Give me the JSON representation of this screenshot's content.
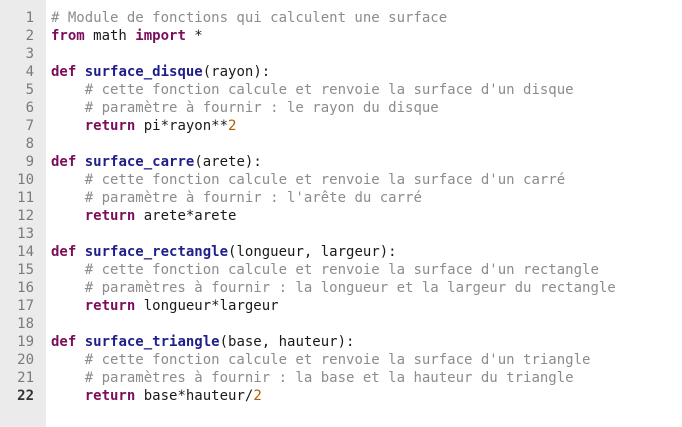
{
  "editor": {
    "current_line": 22,
    "lines": [
      {
        "n": "1",
        "tokens": [
          {
            "t": "cmt",
            "v": "# Module de fonctions qui calculent une surface"
          }
        ]
      },
      {
        "n": "2",
        "tokens": [
          {
            "t": "kw",
            "v": "from"
          },
          {
            "t": "txt",
            "v": " math "
          },
          {
            "t": "kw",
            "v": "import"
          },
          {
            "t": "txt",
            "v": " *"
          }
        ]
      },
      {
        "n": "3",
        "tokens": []
      },
      {
        "n": "4",
        "tokens": [
          {
            "t": "kw",
            "v": "def"
          },
          {
            "t": "txt",
            "v": " "
          },
          {
            "t": "fn",
            "v": "surface_disque"
          },
          {
            "t": "txt",
            "v": "(rayon):"
          }
        ]
      },
      {
        "n": "5",
        "tokens": [
          {
            "t": "txt",
            "v": "    "
          },
          {
            "t": "cmt",
            "v": "# cette fonction calcule et renvoie la surface d'un disque"
          }
        ]
      },
      {
        "n": "6",
        "tokens": [
          {
            "t": "txt",
            "v": "    "
          },
          {
            "t": "cmt",
            "v": "# paramètre à fournir : le rayon du disque"
          }
        ]
      },
      {
        "n": "7",
        "tokens": [
          {
            "t": "txt",
            "v": "    "
          },
          {
            "t": "kw",
            "v": "return"
          },
          {
            "t": "txt",
            "v": " pi*rayon**"
          },
          {
            "t": "num",
            "v": "2"
          }
        ]
      },
      {
        "n": "8",
        "tokens": []
      },
      {
        "n": "9",
        "tokens": [
          {
            "t": "kw",
            "v": "def"
          },
          {
            "t": "txt",
            "v": " "
          },
          {
            "t": "fn",
            "v": "surface_carre"
          },
          {
            "t": "txt",
            "v": "(arete):"
          }
        ]
      },
      {
        "n": "10",
        "tokens": [
          {
            "t": "txt",
            "v": "    "
          },
          {
            "t": "cmt",
            "v": "# cette fonction calcule et renvoie la surface d'un carré"
          }
        ]
      },
      {
        "n": "11",
        "tokens": [
          {
            "t": "txt",
            "v": "    "
          },
          {
            "t": "cmt",
            "v": "# paramètre à fournir : l'arête du carré"
          }
        ]
      },
      {
        "n": "12",
        "tokens": [
          {
            "t": "txt",
            "v": "    "
          },
          {
            "t": "kw",
            "v": "return"
          },
          {
            "t": "txt",
            "v": " arete*arete"
          }
        ]
      },
      {
        "n": "13",
        "tokens": []
      },
      {
        "n": "14",
        "tokens": [
          {
            "t": "kw",
            "v": "def"
          },
          {
            "t": "txt",
            "v": " "
          },
          {
            "t": "fn",
            "v": "surface_rectangle"
          },
          {
            "t": "txt",
            "v": "(longueur, largeur):"
          }
        ]
      },
      {
        "n": "15",
        "tokens": [
          {
            "t": "txt",
            "v": "    "
          },
          {
            "t": "cmt",
            "v": "# cette fonction calcule et renvoie la surface d'un rectangle"
          }
        ]
      },
      {
        "n": "16",
        "tokens": [
          {
            "t": "txt",
            "v": "    "
          },
          {
            "t": "cmt",
            "v": "# paramètres à fournir : la longueur et la largeur du rectangle"
          }
        ]
      },
      {
        "n": "17",
        "tokens": [
          {
            "t": "txt",
            "v": "    "
          },
          {
            "t": "kw",
            "v": "return"
          },
          {
            "t": "txt",
            "v": " longueur*largeur"
          }
        ]
      },
      {
        "n": "18",
        "tokens": []
      },
      {
        "n": "19",
        "tokens": [
          {
            "t": "kw",
            "v": "def"
          },
          {
            "t": "txt",
            "v": " "
          },
          {
            "t": "fn",
            "v": "surface_triangle"
          },
          {
            "t": "txt",
            "v": "(base, hauteur):"
          }
        ]
      },
      {
        "n": "20",
        "tokens": [
          {
            "t": "txt",
            "v": "    "
          },
          {
            "t": "cmt",
            "v": "# cette fonction calcule et renvoie la surface d'un triangle"
          }
        ]
      },
      {
        "n": "21",
        "tokens": [
          {
            "t": "txt",
            "v": "    "
          },
          {
            "t": "cmt",
            "v": "# paramètres à fournir : la base et la hauteur du triangle"
          }
        ]
      },
      {
        "n": "22",
        "tokens": [
          {
            "t": "txt",
            "v": "    "
          },
          {
            "t": "kw",
            "v": "return"
          },
          {
            "t": "txt",
            "v": " base*hauteur/"
          },
          {
            "t": "num",
            "v": "2"
          }
        ]
      }
    ]
  }
}
